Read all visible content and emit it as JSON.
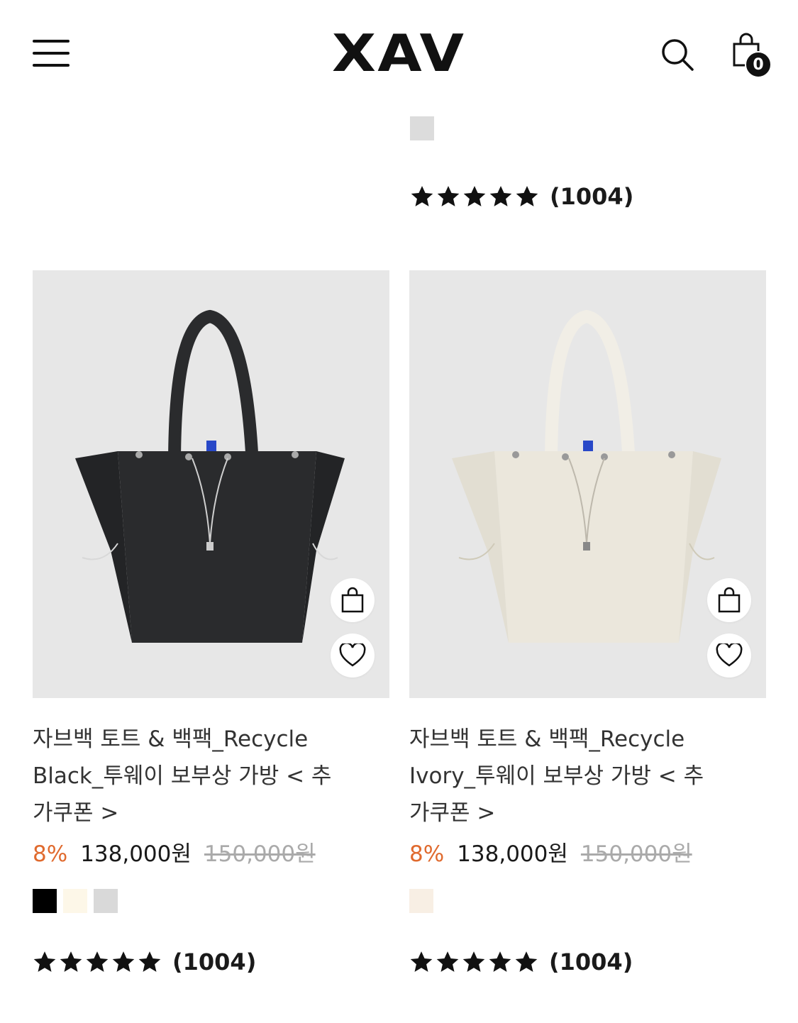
{
  "header": {
    "logo": "XAV",
    "cart_count": "0",
    "icons": [
      "menu-icon",
      "search-icon",
      "shopping-bag-icon"
    ]
  },
  "top_product": {
    "swatches": [
      "#dcdcdc"
    ],
    "rating": {
      "stars": 5,
      "count": "(1004)"
    }
  },
  "products": [
    {
      "title": "자브백 토트 & 백팩_Recycle Black_투웨이 보부상 가방 < 추가쿠폰 >",
      "discount": "8%",
      "price": "138,000원",
      "original_price": "150,000원",
      "bag_color": "#2a2b2d",
      "swatches": [
        "#000000",
        "#fdf7e8",
        "#d9d9d9"
      ],
      "rating": {
        "stars": 5,
        "count": "(1004)"
      }
    },
    {
      "title": "자브백 토트 & 백팩_Recycle Ivory_투웨이 보부상 가방 < 추가쿠폰 >",
      "discount": "8%",
      "price": "138,000원",
      "original_price": "150,000원",
      "bag_color": "#ebe7dc",
      "swatches": [
        "#f8efe4"
      ],
      "rating": {
        "stars": 5,
        "count": "(1004)"
      }
    }
  ],
  "colors": {
    "discount": "#e06a2e",
    "thumb_bg": "#e7e7e7",
    "text": "#333333"
  }
}
